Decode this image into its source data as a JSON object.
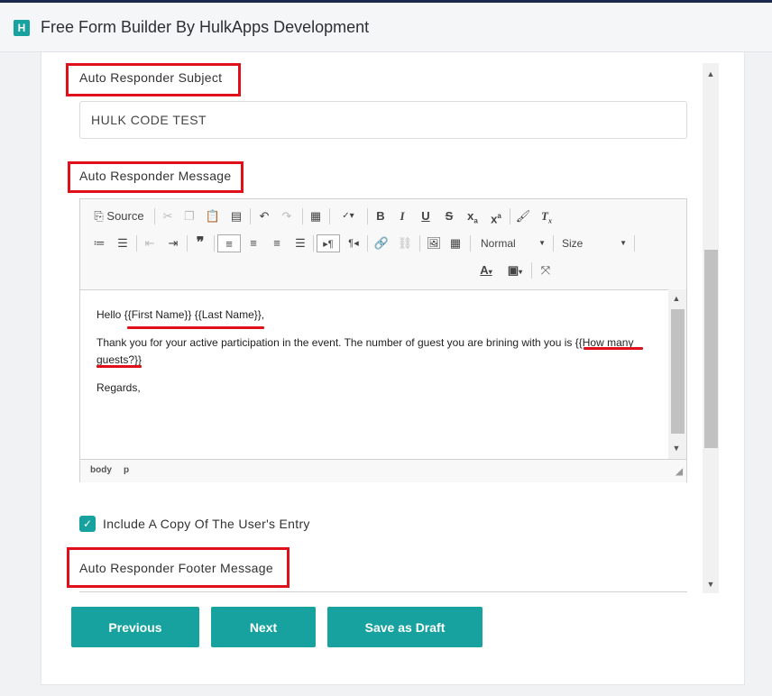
{
  "app": {
    "title": "Free Form Builder By HulkApps Development",
    "logo_glyph": "H"
  },
  "fields": {
    "subject_label": "Auto Responder Subject",
    "subject_value": "HULK CODE TEST",
    "message_label": "Auto Responder Message",
    "footer_label": "Auto Responder Footer Message"
  },
  "editor": {
    "toolbar": {
      "source": "Source",
      "format": "Normal",
      "size": "Size"
    },
    "content": {
      "line1_prefix": "Hello ",
      "first_name_tag": "{{First Name}}",
      "last_name_tag": "{{Last Name}}",
      "line1_suffix": ",",
      "line2_text": "Thank you for your active participation in the event. The number of guest you are brining with you is ",
      "guests_tag_part1": "{{How many",
      "guests_tag_part2": "guests?}}",
      "line3": "Regards,"
    },
    "status": {
      "path1": "body",
      "path2": "p"
    }
  },
  "options": {
    "include_copy_label": "Include A Copy Of The User's Entry",
    "include_copy_checked": true
  },
  "actions": {
    "previous": "Previous",
    "next": "Next",
    "save_draft": "Save as Draft"
  },
  "colors": {
    "accent": "#17a2a0",
    "highlight": "#e0101a",
    "topbar": "#1b2a4a"
  }
}
